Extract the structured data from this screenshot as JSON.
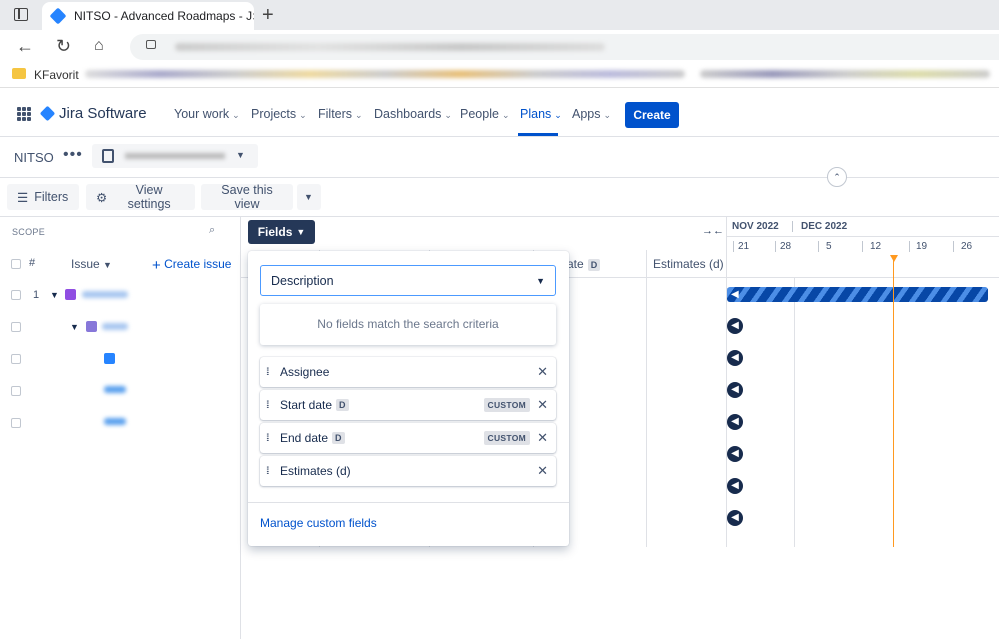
{
  "browser": {
    "tab_title": "NITSO - Advanced Roadmaps - J",
    "tab_close": "×",
    "new_tab": "+",
    "bookmark_label": "KFavorit"
  },
  "nav": {
    "product": "Jira Software",
    "items": [
      "Your work",
      "Projects",
      "Filters",
      "Dashboards",
      "People",
      "Plans",
      "Apps"
    ],
    "create": "Create",
    "accent": "#0052cc"
  },
  "plan": {
    "name": "NITSO",
    "more": "•••"
  },
  "toolbar": {
    "filters": "Filters",
    "view_settings": "View settings",
    "save_view": "Save this view"
  },
  "scope": {
    "label": "SCOPE",
    "hash": "#",
    "issue_header": "Issue",
    "create_issue": "Create issue",
    "row1_number": "1"
  },
  "fields": {
    "button": "Fields",
    "search_value": "Description",
    "no_match": "No fields match the search criteria",
    "rows": [
      {
        "label": "Assignee",
        "badge": "",
        "custom": ""
      },
      {
        "label": "Start date",
        "badge": "D",
        "custom": "CUSTOM"
      },
      {
        "label": "End date",
        "badge": "D",
        "custom": "CUSTOM"
      },
      {
        "label": "Estimates (d)",
        "badge": "",
        "custom": ""
      }
    ],
    "manage": "Manage custom fields"
  },
  "table": {
    "date_header": "ate",
    "date_badge": "D",
    "estimates_header": "Estimates (d)"
  },
  "timeline": {
    "months": [
      "NOV 2022",
      "DEC 2022"
    ],
    "days": [
      "21",
      "28",
      "5",
      "12",
      "19",
      "26"
    ],
    "today_color": "#ff991f"
  }
}
